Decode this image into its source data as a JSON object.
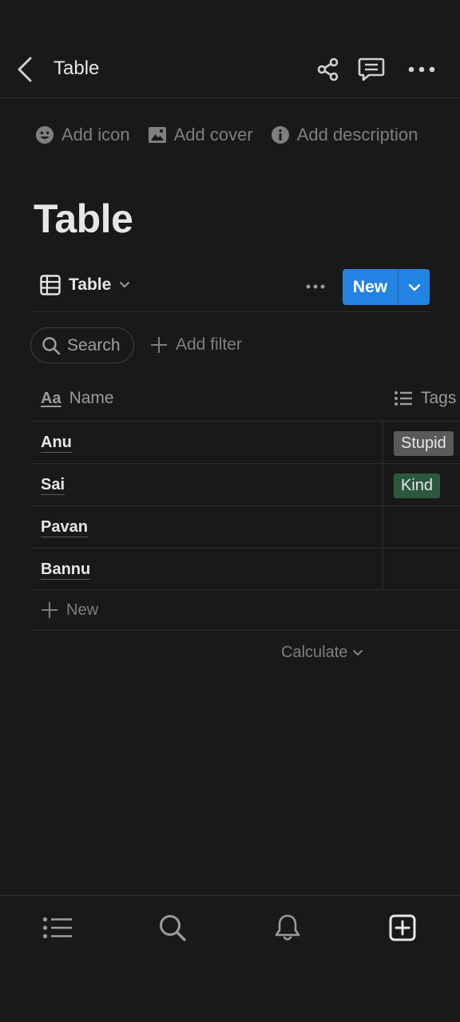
{
  "header": {
    "title": "Table"
  },
  "page_actions": {
    "add_icon": "Add icon",
    "add_cover": "Add cover",
    "add_description": "Add description"
  },
  "page": {
    "title": "Table"
  },
  "view": {
    "label": "Table",
    "new_label": "New"
  },
  "toolbar": {
    "search_label": "Search",
    "add_filter_label": "Add filter"
  },
  "table": {
    "columns": {
      "name": "Name",
      "tags": "Tags",
      "name_icon_text": "Aa"
    },
    "rows": [
      {
        "name": "Anu",
        "tag": "Stupid",
        "tag_color": "#5a5a5a"
      },
      {
        "name": "Sai",
        "tag": "Kind",
        "tag_color": "#2b593f"
      },
      {
        "name": "Pavan",
        "tag": ""
      },
      {
        "name": "Bannu",
        "tag": ""
      }
    ],
    "new_row_label": "New",
    "calculate_label": "Calculate"
  },
  "colors": {
    "background": "#191919",
    "accent": "#2383e2",
    "text": "#e6e6e6",
    "muted": "#7f7f7f"
  },
  "icons": {
    "back": "back-icon",
    "share": "share-icon",
    "comment": "comment-icon",
    "more": "more-icon",
    "table_view": "table-icon",
    "search": "search-icon",
    "plus": "plus-icon",
    "list": "list-icon",
    "bell": "bell-icon",
    "new_page": "new-page-icon"
  }
}
